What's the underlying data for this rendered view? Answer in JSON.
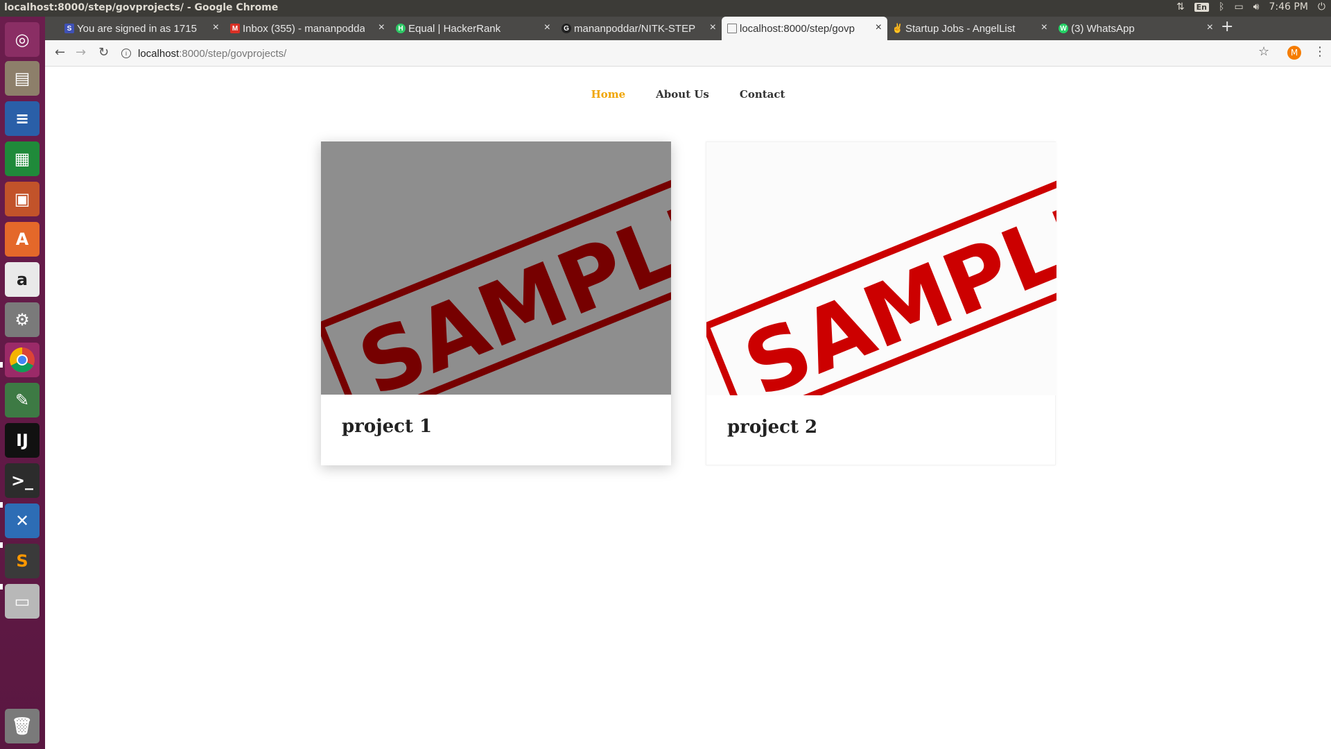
{
  "system": {
    "window_title": "localhost:8000/step/govprojects/ - Google Chrome",
    "keyboard": "En",
    "clock": "7:46 PM"
  },
  "tabs": [
    {
      "label": "You are signed in as 1715",
      "icon": "S",
      "color": "#3f51b5"
    },
    {
      "label": "Inbox (355) - mananpoddar",
      "icon": "M",
      "color": "#d93025"
    },
    {
      "label": "Equal | HackerRank",
      "icon": "H",
      "color": "#2ec866"
    },
    {
      "label": "mananpoddar/NITK-STEP",
      "icon": "G",
      "color": "#222222"
    },
    {
      "label": "localhost:8000/step/govp",
      "icon": "",
      "color": "#777777"
    },
    {
      "label": "Startup Jobs - AngelList",
      "icon": "✌",
      "color": "#555555"
    },
    {
      "label": "(3) WhatsApp",
      "icon": "W",
      "color": "#25d366"
    }
  ],
  "address": {
    "host": "localhost",
    "path": ":8000/step/govprojects/"
  },
  "profile_initial": "M",
  "nav": {
    "home": "Home",
    "about": "About Us",
    "contact": "Contact"
  },
  "projects": [
    {
      "title": "project 1",
      "stamp": "SAMPLE"
    },
    {
      "title": "project 2",
      "stamp": "SAMPLE"
    }
  ],
  "colors": {
    "accent": "#f0a500",
    "stamp_red": "#cc0000"
  }
}
